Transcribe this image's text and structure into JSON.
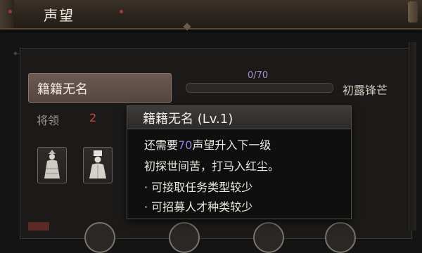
{
  "header": {
    "title": "声望"
  },
  "reputation": {
    "name": "籍籍无名",
    "progress_text": "0/70",
    "progress_fraction": 0,
    "next_rank": "初露锋芒",
    "accent_color": "#8c7fd0"
  },
  "generals": {
    "label": "将领",
    "count": "2",
    "slots": [
      {
        "icon": "female-general-portrait-icon"
      },
      {
        "icon": "male-general-portrait-icon"
      }
    ]
  },
  "tooltip": {
    "title": "籍籍无名 (Lv.1)",
    "need_prefix": "还需要",
    "need_value": "70",
    "need_suffix": "声望升入下一级",
    "flavor": "初探世间苦，打马入红尘。",
    "bullet_1": "· 可接取任务类型较少",
    "bullet_2": "· 可招募人才种类较少"
  }
}
